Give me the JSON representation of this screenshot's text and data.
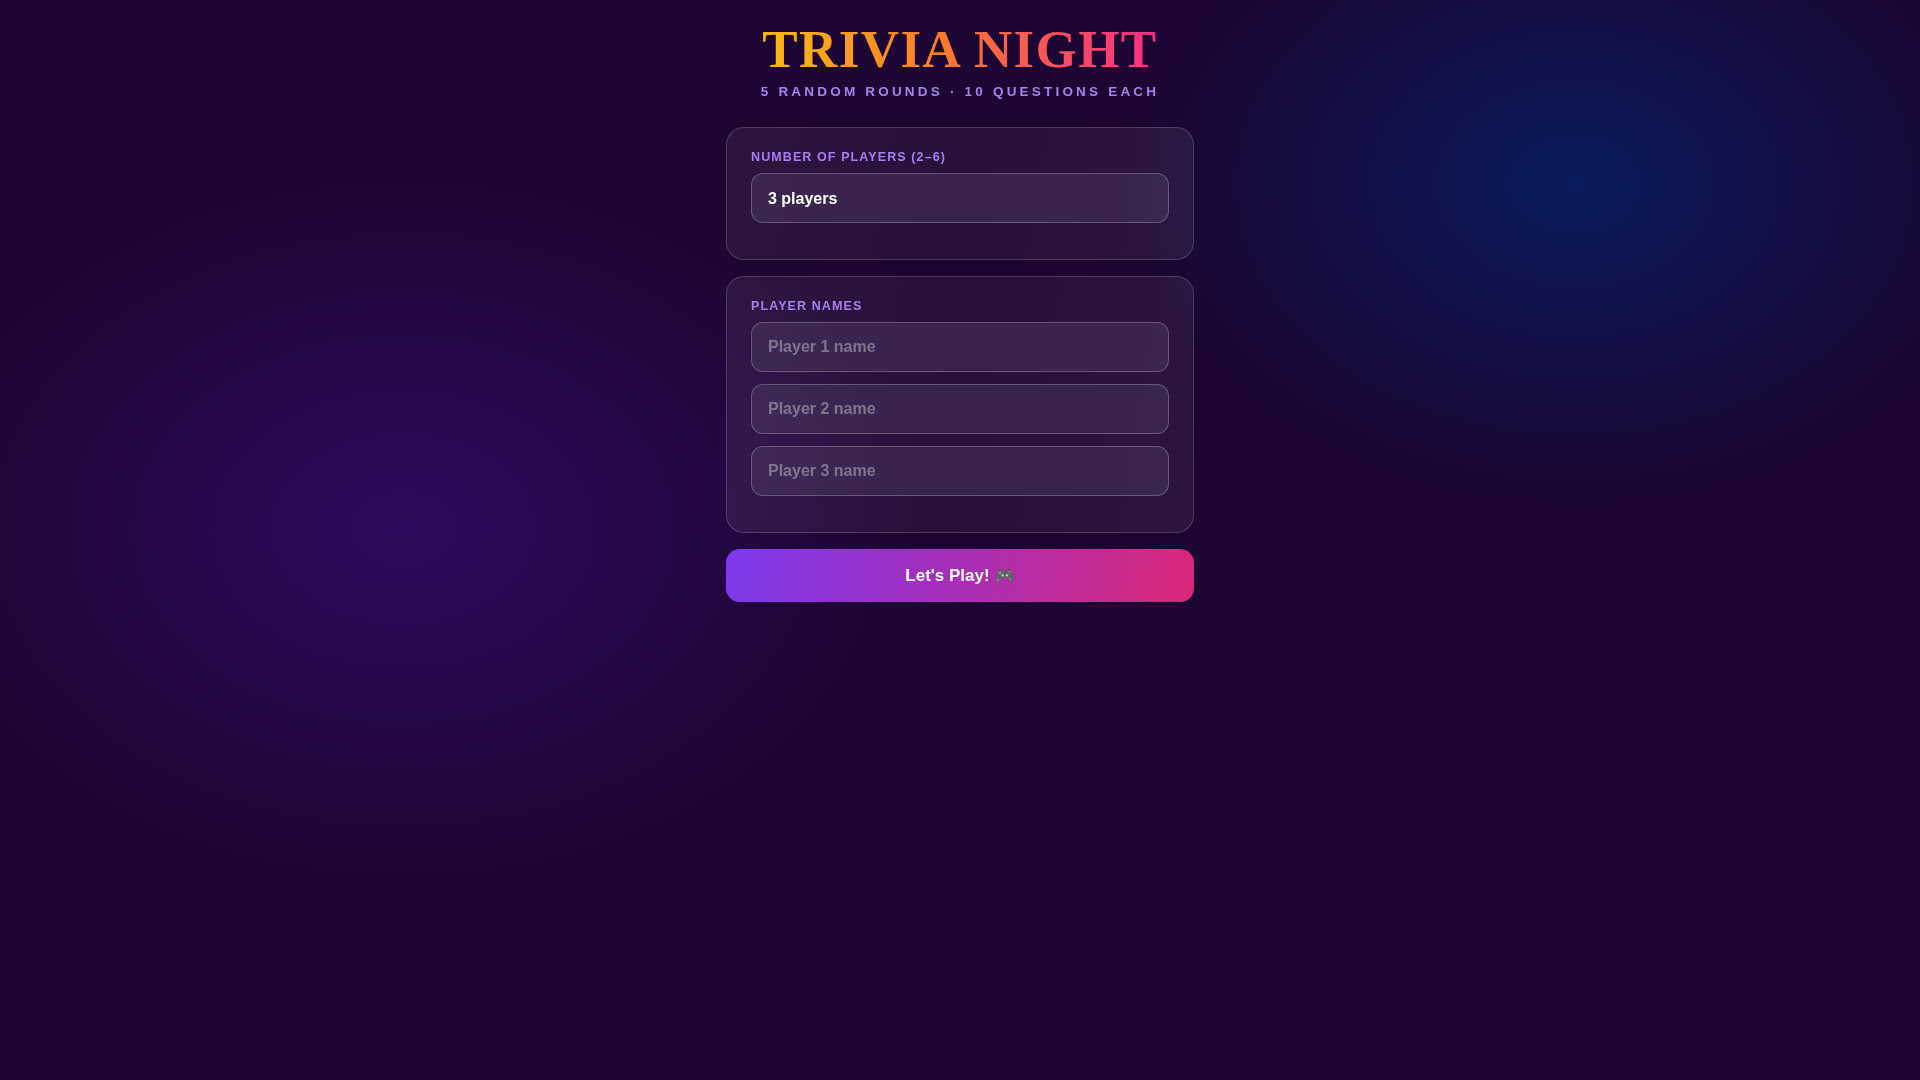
{
  "header": {
    "title": "TRIVIA NIGHT",
    "subtitle": "5 RANDOM ROUNDS · 10 QUESTIONS EACH"
  },
  "player_count": {
    "label": "NUMBER OF PLAYERS (2–6)",
    "value": "3 players"
  },
  "player_names": {
    "label": "PLAYER NAMES",
    "fields": [
      {
        "placeholder": "Player 1 name"
      },
      {
        "placeholder": "Player 2 name"
      },
      {
        "placeholder": "Player 3 name"
      }
    ]
  },
  "start_button": {
    "label": "Let's Play!",
    "icon": "🎮"
  }
}
